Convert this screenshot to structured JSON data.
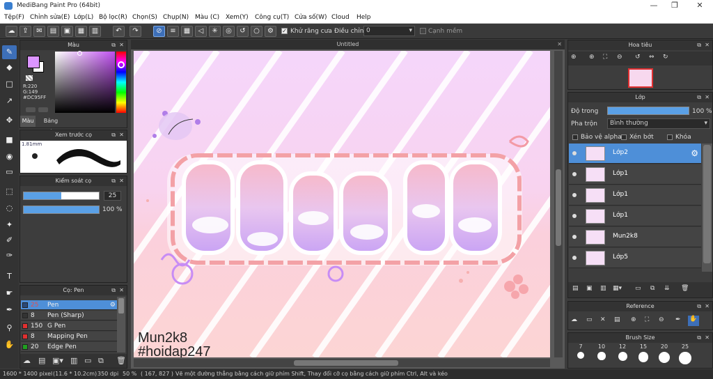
{
  "app": {
    "title": "MediBang Paint Pro (64bit)"
  },
  "menu": [
    "Tệp(F)",
    "Chỉnh sửa(E)",
    "Lớp(L)",
    "Bộ lọc(R)",
    "Chọn(S)",
    "Chụp(N)",
    "Màu (C)",
    "Xem(Y)",
    "Công cụ(T)",
    "Cửa số(W)",
    "Cloud",
    "Help"
  ],
  "toolbar": {
    "antialias": "Khử răng cưa",
    "adjust_label": "Điều chỉnh",
    "adjust_value": "0",
    "snap": "Cạnh mềm"
  },
  "color_panel": {
    "title": "Màu",
    "r": "R:220",
    "g": "G:149",
    "hex": "#DC95FF",
    "tab_color": "Màu",
    "tab_palette": "Bảng màu",
    "primary": "#dc95ff",
    "secondary": "#ffffff"
  },
  "preview_panel": {
    "title": "Xem trước cọ",
    "size": "1.81mm"
  },
  "brush_control": {
    "title": "Kiểm soát cọ",
    "size": "25",
    "opacity": "100 %",
    "size_fraction": 0.5,
    "opacity_fraction": 1.0
  },
  "brush_panel": {
    "title": "Cọ: Pen",
    "items": [
      {
        "size": "25",
        "name": "Pen",
        "color": "#2b4a78",
        "selected": true
      },
      {
        "size": "8",
        "name": "Pen (Sharp)",
        "color": "#333333",
        "selected": false
      },
      {
        "size": "150",
        "name": "G Pen",
        "color": "#e03030",
        "selected": false
      },
      {
        "size": "8",
        "name": "Mapping Pen",
        "color": "#e03030",
        "selected": false
      },
      {
        "size": "20",
        "name": "Edge Pen",
        "color": "#20a020",
        "selected": false
      }
    ]
  },
  "canvas": {
    "tab": "Untitled",
    "watermark1": "Mun2k8",
    "watermark2": "#hoidap247"
  },
  "navigator": {
    "title": "Hoa tiêu"
  },
  "layer_panel": {
    "title": "Lớp",
    "opacity_label": "Độ trong",
    "opacity_value": "100 %",
    "opacity_fraction": 1.0,
    "blend_label": "Pha trộn",
    "blend_value": "Bình thường",
    "protect_alpha": "Bảo vệ alpha",
    "clipping": "Xén bớt",
    "lock": "Khóa",
    "layers": [
      {
        "name": "Lớp2",
        "selected": true
      },
      {
        "name": "Lớp1",
        "selected": false
      },
      {
        "name": "Lớp1",
        "selected": false
      },
      {
        "name": "Lớp1",
        "selected": false
      },
      {
        "name": "Mun2k8",
        "selected": false
      },
      {
        "name": "Lớp5",
        "selected": false
      }
    ]
  },
  "reference_panel": {
    "title": "Reference"
  },
  "brushsize_panel": {
    "title": "Brush Size",
    "sizes": [
      "7",
      "10",
      "12",
      "15",
      "20",
      "25"
    ]
  },
  "status": {
    "dimensions": "1600 * 1400 pixel",
    "physical": "(11.6 * 10.2cm)",
    "dpi": "350 dpi",
    "zoom": "50 %",
    "coords": "( 167, 827 )",
    "hint": "Vẽ một đường thẳng bằng cách giữ phím Shift, Thay đổi cỡ cọ bằng cách giữ phím Ctrl, Alt và kéo"
  }
}
